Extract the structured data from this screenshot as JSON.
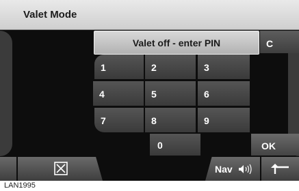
{
  "header": {
    "title": "Valet Mode"
  },
  "display": {
    "prompt": "Valet off - enter PIN"
  },
  "keypad": {
    "keys": [
      "1",
      "2",
      "3",
      "4",
      "5",
      "6",
      "7",
      "8",
      "9",
      "0"
    ],
    "clear_label": "C",
    "ok_label": "OK"
  },
  "bottombar": {
    "close_icon": "close-box-icon",
    "nav_label": "Nav",
    "volume_icon": "speaker-volume-icon",
    "back_icon": "return-arrow-icon"
  },
  "caption": "LAN1995"
}
